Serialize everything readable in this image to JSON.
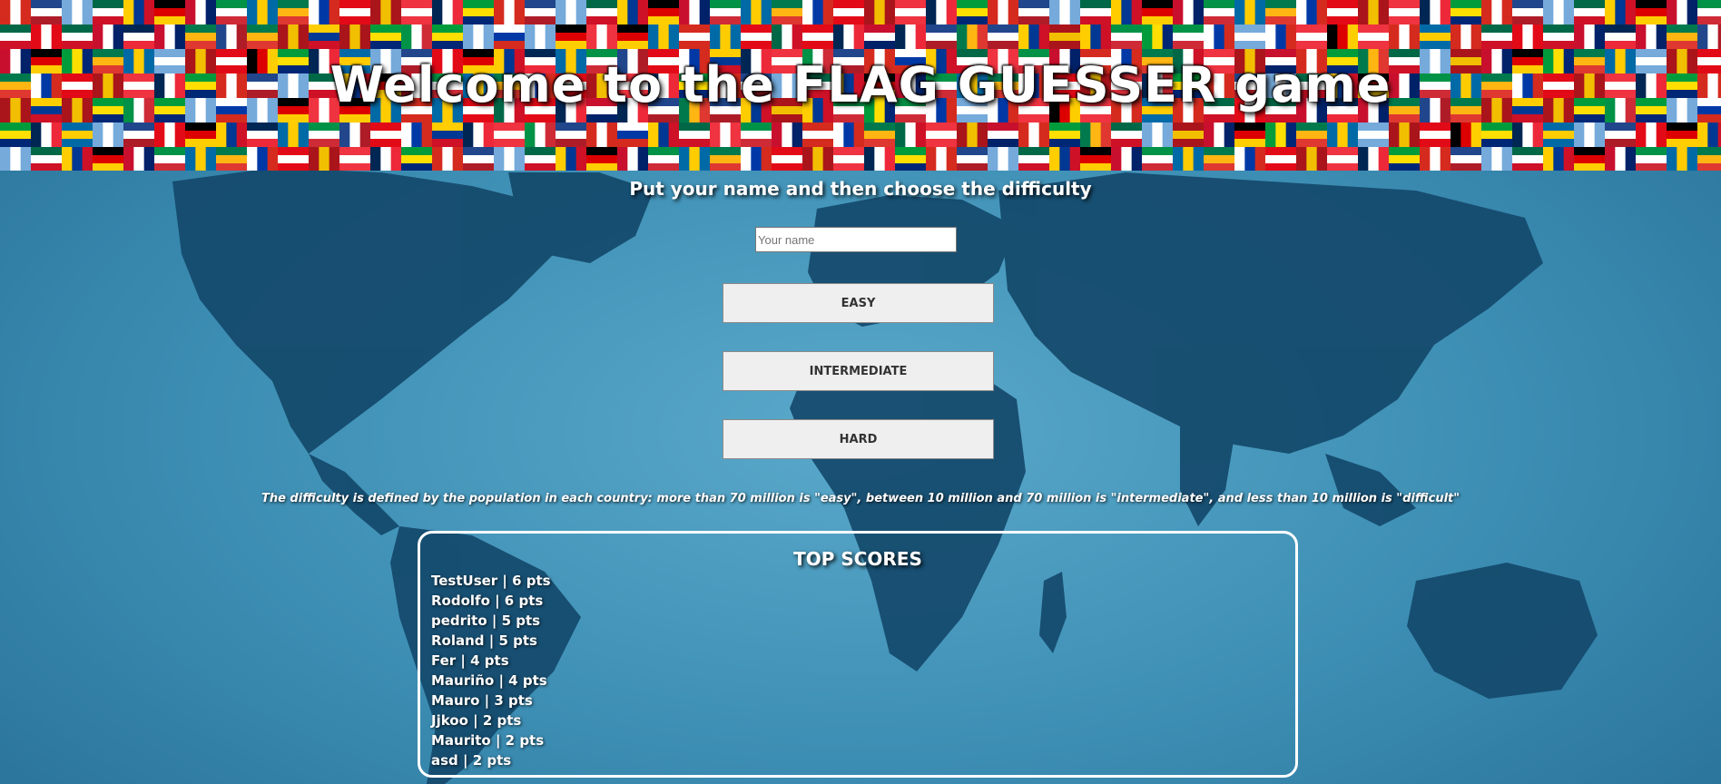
{
  "header": {
    "title": "Welcome to the FLAG GUESSER game"
  },
  "form": {
    "instructions": "Put your name and then choose the difficulty",
    "name_placeholder": "Your name",
    "name_value": ""
  },
  "difficulty": {
    "easy_label": "EASY",
    "intermediate_label": "INTERMEDIATE",
    "hard_label": "HARD",
    "note": "The difficulty is defined by the population in each country: more than 70 million is \"easy\", between 10 million and 70 million is \"intermediate\", and less than 10 million is \"difficult\""
  },
  "scores": {
    "title": "TOP SCORES",
    "entries": [
      "TestUser | 6 pts",
      "Rodolfo | 6 pts",
      "pedrito | 5 pts",
      "Roland | 5 pts",
      "Fer | 4 pts",
      "Mauriño | 4 pts",
      "Mauro | 3 pts",
      "Jjkoo | 2 pts",
      "Maurito | 2 pts",
      "asd | 2 pts"
    ]
  },
  "colors": {
    "ocean": "#3f8db0",
    "land": "#13496b",
    "button_bg": "#efefef",
    "text": "#ffffff"
  }
}
